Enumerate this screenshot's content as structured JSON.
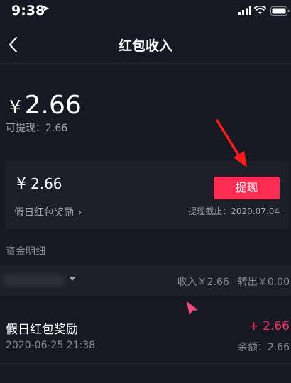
{
  "status_bar": {
    "time": "9:38"
  },
  "nav": {
    "title": "红包收入"
  },
  "balance": {
    "currency": "¥",
    "amount": "2.66",
    "available_text": "可提现：2.66"
  },
  "card": {
    "currency": "¥",
    "amount": "2.66",
    "reward_label": "假日红包奖励",
    "withdraw_label": "提现",
    "deadline_text": "提现截止：2020.07.04"
  },
  "section": {
    "title": "资金明细"
  },
  "filter": {
    "income_text": "收入￥2.66",
    "expense_text": "转出￥0.00"
  },
  "transactions": [
    {
      "title": "假日红包奖励",
      "amount": "+ 2.66",
      "datetime": "2020-06-25 21:38",
      "balance": "余额：2.66"
    }
  ],
  "colors": {
    "background": "#161823",
    "card": "#1e2029",
    "accent": "#fe2c55",
    "secondary_text": "#a4a6ad"
  },
  "icons": [
    "location-arrow-icon",
    "signal-icon",
    "wifi-icon",
    "battery-icon",
    "back-chevron-icon",
    "chevron-right-icon",
    "caret-down-icon",
    "annotation-arrow-icon",
    "pointer-cursor-icon"
  ]
}
